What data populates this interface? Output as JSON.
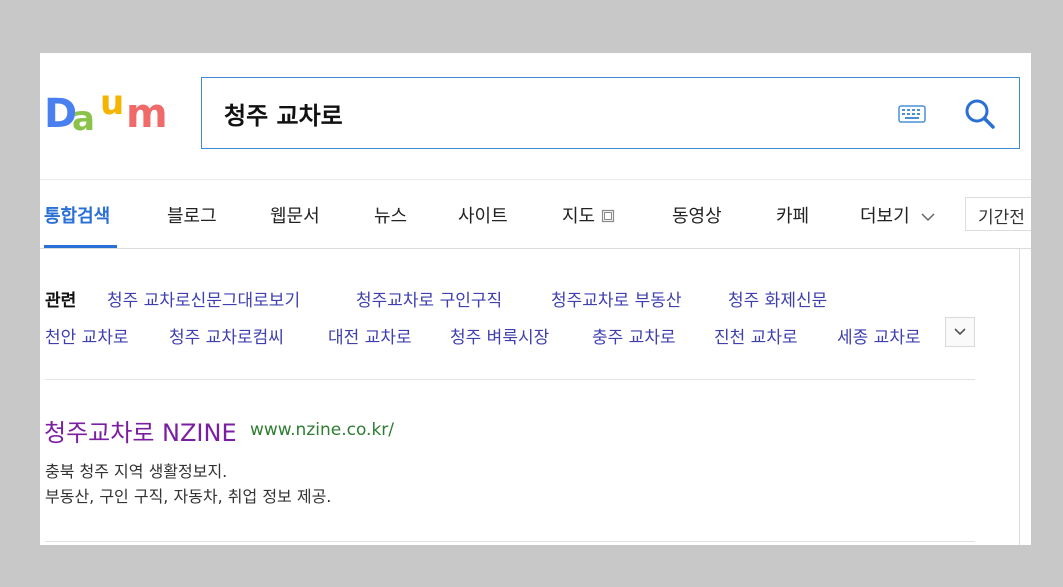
{
  "logo": {
    "letters": [
      "D",
      "a",
      "u",
      "m"
    ]
  },
  "search": {
    "query": "청주 교차로"
  },
  "tabs": [
    {
      "label": "통합검색"
    },
    {
      "label": "블로그"
    },
    {
      "label": "웹문서"
    },
    {
      "label": "뉴스"
    },
    {
      "label": "사이트"
    },
    {
      "label": "지도"
    },
    {
      "label": "동영상"
    },
    {
      "label": "카페"
    },
    {
      "label": "더보기"
    }
  ],
  "period_label": "기간전",
  "related": {
    "label": "관련",
    "items": [
      "청주 교차로신문그대로보기",
      "청주교차로 구인구직",
      "청주교차로 부동산",
      "청주 화제신문",
      "천안 교차로",
      "청주 교차로컴씨",
      "대전 교차로",
      "청주 벼룩시장",
      "충주 교차로",
      "진천 교차로",
      "세종 교차로"
    ]
  },
  "result": {
    "title": "청주교차로 NZINE",
    "url": "www.nzine.co.kr/",
    "desc_line1": "충북 청주 지역 생활정보지.",
    "desc_line2": "부동산, 구인 구직, 자동차, 취업 정보 제공."
  },
  "colors": {
    "accent": "#2a6fd6",
    "link": "#3f3fb0",
    "title": "#7b1fa2",
    "url": "#2e7d32"
  }
}
